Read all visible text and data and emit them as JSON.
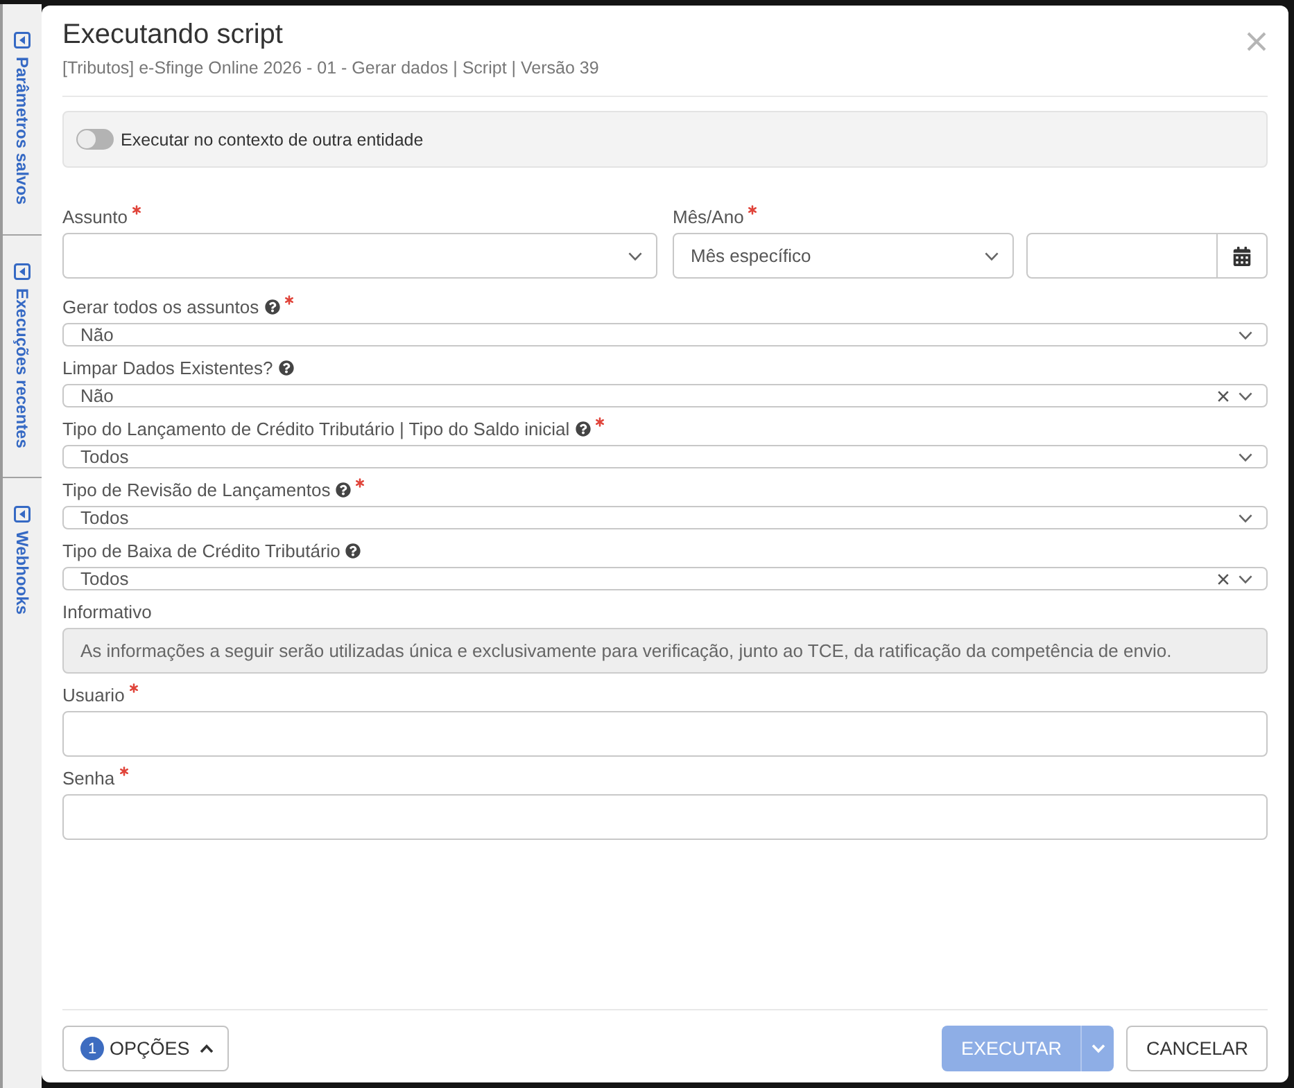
{
  "side_tabs": [
    {
      "label": "Parâmetros salvos"
    },
    {
      "label": "Execuções recentes"
    },
    {
      "label": "Webhooks"
    }
  ],
  "dialog": {
    "title": "Executando script",
    "subtitle": "[Tributos] e-Sfinge Online 2026 - 01 - Gerar dados | Script | Versão 39"
  },
  "toggle": {
    "label": "Executar no contexto de outra entidade",
    "on": false
  },
  "rows": [
    [
      {
        "kind": "select",
        "label": "Assunto",
        "required": true,
        "help": false,
        "clearable": false
      },
      {
        "kind": "period",
        "label": "Mês/Ano",
        "required": true,
        "help": false,
        "value": "Mês específico"
      }
    ],
    [
      {
        "kind": "select",
        "label": "Gerar todos os assuntos",
        "required": true,
        "help": true,
        "clearable": false,
        "value": "Não"
      }
    ],
    [
      {
        "kind": "select",
        "label": "Limpar Dados Existentes?",
        "required": false,
        "help": true,
        "clearable": true,
        "value": "Não"
      }
    ],
    [
      {
        "kind": "select",
        "label": "Tipo do Lançamento de Crédito Tributário | Tipo do Saldo inicial",
        "required": true,
        "help": true,
        "clearable": false,
        "value": "Todos"
      }
    ],
    [
      {
        "kind": "select",
        "label": "Tipo de Revisão de Lançamentos",
        "required": true,
        "help": true,
        "clearable": false,
        "value": "Todos"
      }
    ],
    [
      {
        "kind": "select",
        "label": "Tipo de Baixa de Crédito Tributário",
        "required": false,
        "help": true,
        "clearable": true,
        "value": "Todos"
      }
    ],
    [
      {
        "kind": "info",
        "label": "Informativo",
        "required": false,
        "help": false,
        "value": "As informações a seguir serão utilizadas única e exclusivamente para verificação, junto ao TCE, da ratificação da competência de envio."
      }
    ],
    [
      {
        "kind": "input",
        "label": "Usuario",
        "required": true,
        "help": false
      }
    ],
    [
      {
        "kind": "input",
        "label": "Senha",
        "required": true,
        "help": false
      }
    ]
  ],
  "footer": {
    "options": {
      "label": "OPÇÕES",
      "badge": "1"
    },
    "execute": {
      "label": "EXECUTAR",
      "disabled": true
    },
    "cancel": {
      "label": "CANCELAR"
    }
  }
}
